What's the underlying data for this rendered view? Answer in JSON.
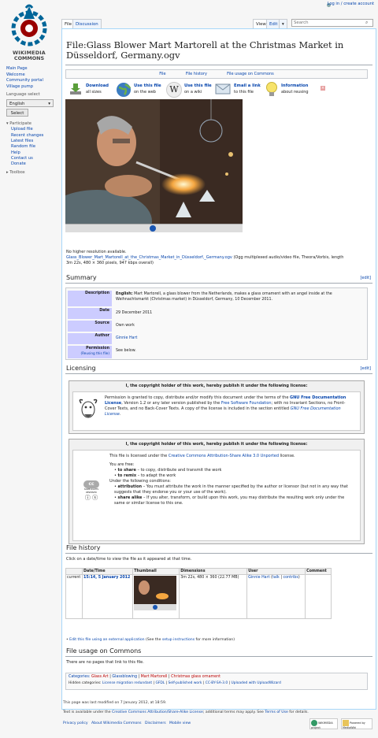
{
  "personal": {
    "login": "Log in / create account"
  },
  "logo": {
    "line1": "WIKIMEDIA",
    "line2": "COMMONS"
  },
  "tabs": {
    "file": "File",
    "discussion": "Discussion",
    "view": "View",
    "edit": "Edit",
    "more": "▾",
    "search_placeholder": "Search"
  },
  "sidebar": {
    "nav": [
      "Main Page",
      "Welcome",
      "Community portal",
      "Village pump"
    ],
    "language_select_label": "Language select",
    "language_value": "English",
    "select_button": "Select",
    "participate_heading": "Participate",
    "participate": [
      "Upload file",
      "Recent changes",
      "Latest files",
      "Random file",
      "Help",
      "Contact us",
      "Donate"
    ],
    "toolbox": "Toolbox"
  },
  "page": {
    "title": "File:Glass Blower Mart Martorell at the Christmas Market in Düsseldorf, Germany.ogv"
  },
  "filetoc": [
    "File",
    "File history",
    "File usage on Commons"
  ],
  "actions": [
    {
      "title": "Download",
      "sub": "all sizes",
      "icon": "download-icon"
    },
    {
      "title": "Use this file",
      "sub": "on the web",
      "icon": "globe-icon"
    },
    {
      "title": "Use this file",
      "sub": "on a wiki",
      "icon": "wikipedia-icon"
    },
    {
      "title": "Email a link",
      "sub": "to this file",
      "icon": "email-icon"
    },
    {
      "title": "Information",
      "sub": "about reusing",
      "icon": "lightbulb-icon"
    }
  ],
  "file_info": {
    "no_higher": "No higher resolution available.",
    "link": "Glass_Blower_Mart_Martorell_at_the_Christmas_Market_in_Düsseldorf,_Germany.ogv",
    "meta1": " (Ogg multiplexed audio/video file, Theora/Vorbis, length",
    "meta2": "3m 22s, 480 × 360 pixels, 947 kbps overall)"
  },
  "summary": {
    "heading": "Summary",
    "edit": "[edit]",
    "desc_label": "Description",
    "desc_lang": "English:",
    "desc_text": " Mart Martorell, a glass blower from the Netherlands, makes a glass ornament with an angel inside at the Weihnachtsmarkt (Christmas market) in Düsseldorf, Germany, 10 December 2011.",
    "date_label": "Date",
    "date": "29 December 2011",
    "source_label": "Source",
    "source": "Own work",
    "author_label": "Author",
    "author": "Ginnie Hart",
    "perm_label": "Permission",
    "perm_sub": "(Reusing this file)",
    "perm": "See below."
  },
  "licensing": {
    "heading": "Licensing",
    "edit": "[edit]",
    "header": "I, the copyright holder of this work, hereby publish it under the following license:",
    "gfdl_1": "Permission is granted to copy, distribute and/or modify this document under the terms of the ",
    "gfdl_link1": "GNU Free Documentation License",
    "gfdl_2": ", Version 1.2 or any later version published by the ",
    "gfdl_link2": "Free Software Foundation",
    "gfdl_3": "; with no Invariant Sections, no Front-Cover Texts, and no Back-Cover Texts. A copy of the license is included in the section entitled ",
    "gfdl_link3": "GNU Free Documentation License",
    "gfdl_4": ".",
    "cc_pre": "This file is licensed under the ",
    "cc_link": "Creative Commons Attribution-Share Alike 3.0 Unported",
    "cc_post": " license.",
    "cc_badge": "SOME RIGHTS RESERVED",
    "free": "You are free:",
    "share_b": "to share",
    "share": " – to copy, distribute and transmit the work",
    "remix_b": "to remix",
    "remix": " – to adapt the work",
    "under": "Under the following conditions:",
    "attr_b": "attribution",
    "attr": " – You must attribute the work in the manner specified by the author or licensor (but not in any way that suggests that they endorse you or your use of the work).",
    "sa_b": "share alike",
    "sa": " – If you alter, transform, or build upon this work, you may distribute the resulting work only under the same or similar license to this one."
  },
  "history": {
    "heading": "File history",
    "intro": "Click on a date/time to view the file as it appeared at that time.",
    "cols": [
      "",
      "Date/Time",
      "Thumbnail",
      "Dimensions",
      "User",
      "Comment"
    ],
    "row": {
      "status": "current",
      "datetime": "15:14, 5 January 2012",
      "dims": "3m 22s, 480 × 360 (22.77 MB)",
      "user": "Ginnie Hart",
      "talk": "talk",
      "contribs": "contribs"
    }
  },
  "external": {
    "link": "Edit this file using an external application",
    "pre": " (See the ",
    "setup": "setup instructions",
    "post": " for more information)"
  },
  "usage": {
    "heading": "File usage on Commons",
    "text": "There are no pages that link to this file."
  },
  "categories": {
    "label": "Categories:",
    "items": [
      "Glass Art",
      "Glassblowing",
      "Mart Martorell",
      "Christmas glass ornament"
    ],
    "hidden_label": "Hidden categories:",
    "hidden": [
      "License migration redundant",
      "GFDL",
      "Self-published work",
      "CC-BY-SA-3.0",
      "Uploaded with UploadWizard"
    ]
  },
  "footer": {
    "modified": "This page was last modified on 7 January 2012, at 18:59.",
    "text_pre": "Text is available under the ",
    "text_link": "Creative Commons Attribution/Share-Alike License",
    "text_mid": "; additional terms may apply. See ",
    "terms": "Terms of Use",
    "text_post": " for details.",
    "links": [
      "Privacy policy",
      "About Wikimedia Commons",
      "Disclaimers",
      "Mobile view"
    ],
    "wmf": "WIKIMEDIA project",
    "mw": "Powered by MediaWiki"
  },
  "colors": {
    "link": "#0645ad",
    "label_bg": "#ccccff",
    "border": "#a7d7f9"
  }
}
